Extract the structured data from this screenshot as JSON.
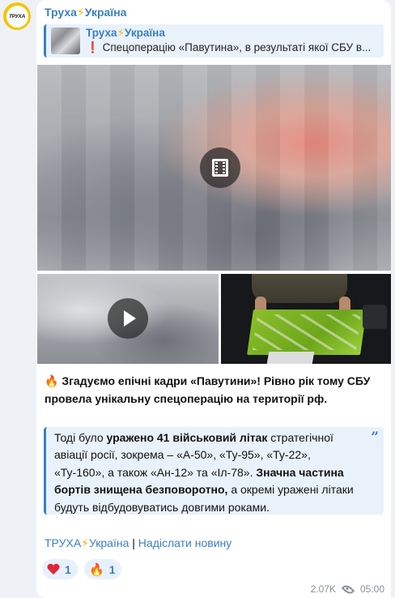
{
  "channel": {
    "avatar_text": "ТРУХА",
    "name_part1": "Труха",
    "name_bolt": "⚡",
    "name_part2": "Україна"
  },
  "reply": {
    "title_part1": "Труха",
    "title_bolt": "⚡",
    "title_part2": "Україна",
    "text_emoji": "❗",
    "text": "Спецоперацію «Павутина», в результаті якої СБУ в..."
  },
  "media": {
    "main_icon": "film-icon",
    "left_icon": "play-icon"
  },
  "post": {
    "emoji": "🔥",
    "headline": "Згадуємо епічні кадри «Павутини»! Рівно рік тому СБУ провела унікальну спецоперацію на території рф."
  },
  "quote": {
    "p1": "Тоді було ",
    "b1": "уражено 41 військовий літак",
    "p2": " стратегічної авіації росії, зокрема – «А-50», «Ту-95», «Ту-22», «Ту-160», а також «Ан-12» та «Іл-78». ",
    "b2": "Значна частина бортів знищена безповоротно,",
    "p3": " а окремі уражені літаки будуть відбудовуватись довгими роками.",
    "mark": "”"
  },
  "links": {
    "channel_part1": "ТРУХА",
    "channel_bolt": "⚡",
    "channel_part2": "Україна",
    "separator": " | ",
    "send_news": "Надіслати новину"
  },
  "reactions": [
    {
      "emoji_name": "heart-icon",
      "count": "1"
    },
    {
      "emoji": "🔥",
      "count": "1"
    }
  ],
  "meta": {
    "views": "2.07K",
    "time": "05:00"
  },
  "colors": {
    "accent": "#3a7fc4",
    "avatar_ring": "#f5c400",
    "quote_bg": "#e9f2fb"
  }
}
